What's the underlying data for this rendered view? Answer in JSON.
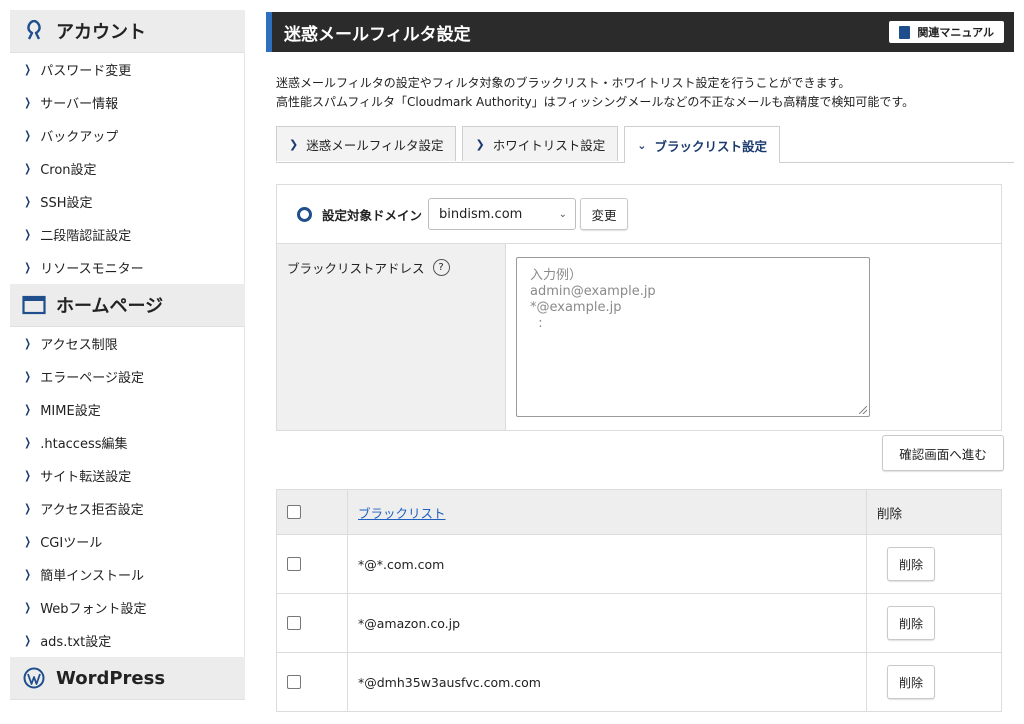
{
  "sidebar": {
    "account": {
      "title": "アカウント",
      "items": [
        "パスワード変更",
        "サーバー情報",
        "バックアップ",
        "Cron設定",
        "SSH設定",
        "二段階認証設定",
        "リソースモニター"
      ]
    },
    "homepage": {
      "title": "ホームページ",
      "items": [
        "アクセス制限",
        "エラーページ設定",
        "MIME設定",
        ".htaccess編集",
        "サイト転送設定",
        "アクセス拒否設定",
        "CGIツール",
        "簡単インストール",
        "Webフォント設定",
        "ads.txt設定"
      ]
    },
    "wordpress": {
      "title": "WordPress"
    }
  },
  "header": {
    "title": "迷惑メールフィルタ設定",
    "manual_label": "関連マニュアル"
  },
  "description": {
    "line1": "迷惑メールフィルタの設定やフィルタ対象のブラックリスト・ホワイトリスト設定を行うことができます。",
    "line2": "高性能スパムフィルタ「Cloudmark Authority」はフィッシングメールなどの不正なメールも高精度で検知可能です。"
  },
  "tabs": [
    {
      "label": "迷惑メールフィルタ設定"
    },
    {
      "label": "ホワイトリスト設定"
    },
    {
      "label": "ブラックリスト設定",
      "active": true
    }
  ],
  "form": {
    "domain_label": "設定対象ドメイン",
    "domain_value": "bindism.com",
    "change_label": "変更",
    "blacklist_label": "ブラックリストアドレス",
    "help_glyph": "?",
    "textarea_placeholder": "入力例）\nadmin@example.jp\n*@example.jp\n  :",
    "confirm_label": "確認画面へ進む"
  },
  "table": {
    "header": {
      "list_label": "ブラックリスト",
      "delete_label": "削除"
    },
    "rows": [
      {
        "address": "*@*.com.com",
        "delete_label": "削除"
      },
      {
        "address": "*@amazon.co.jp",
        "delete_label": "削除"
      },
      {
        "address": "*@dmh35w3ausfvc.com.com",
        "delete_label": "削除"
      }
    ]
  },
  "colors": {
    "accent": "#2f6fbf",
    "title_bar": "#2b2b2b",
    "nav_chevron": "#1a3a6e"
  }
}
